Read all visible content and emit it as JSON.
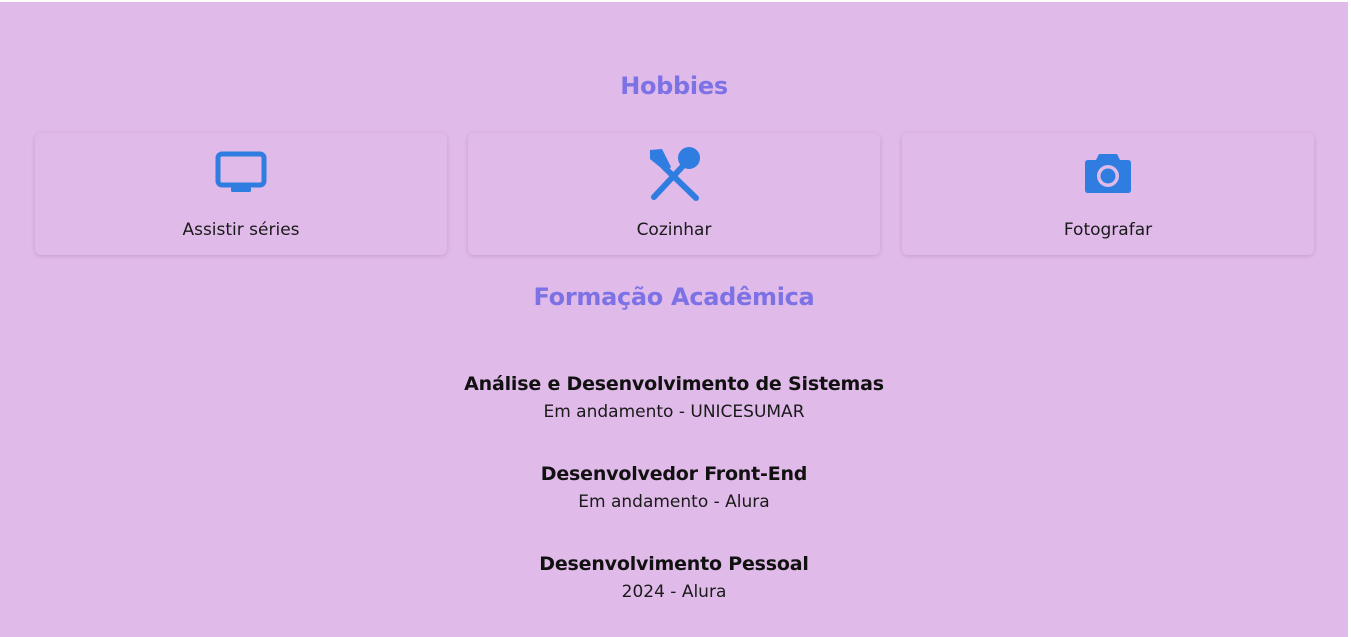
{
  "hobbies": {
    "title": "Hobbies",
    "items": [
      {
        "label": "Assistir séries",
        "icon": "tv-icon"
      },
      {
        "label": "Cozinhar",
        "icon": "utensils-icon"
      },
      {
        "label": "Fotografar",
        "icon": "camera-icon"
      }
    ]
  },
  "formacao": {
    "title": "Formação Acadêmica",
    "courses": [
      {
        "name": "Análise e Desenvolvimento de Sistemas",
        "info": "Em andamento - UNICESUMAR"
      },
      {
        "name": "Desenvolvedor Front-End",
        "info": "Em andamento - Alura"
      },
      {
        "name": "Desenvolvimento Pessoal",
        "info": "2024 - Alura"
      }
    ]
  },
  "colors": {
    "background": "#e0bae8",
    "heading": "#7c72e6",
    "icon": "#2f7de1",
    "text": "#111111"
  }
}
